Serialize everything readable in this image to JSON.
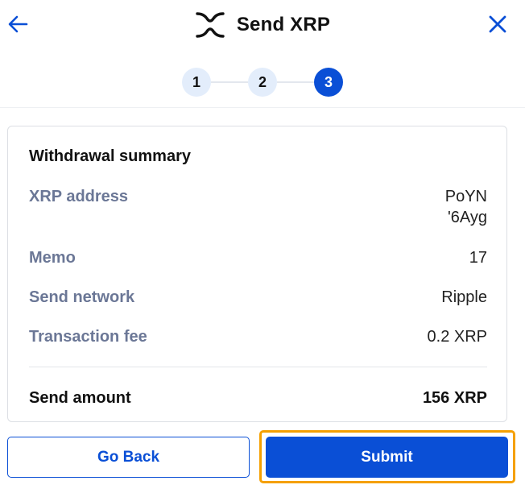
{
  "header": {
    "title": "Send XRP",
    "back_icon": "arrow-left-icon",
    "close_icon": "close-icon",
    "logo_icon": "xrp-logo-icon",
    "accent_color": "#0a4fd6"
  },
  "steps": [
    {
      "label": "1",
      "active": false
    },
    {
      "label": "2",
      "active": false
    },
    {
      "label": "3",
      "active": true
    }
  ],
  "summary": {
    "title": "Withdrawal summary",
    "address_label": "XRP address",
    "address_line1": "PoYN",
    "address_line2": "'6Ayg",
    "memo_label": "Memo",
    "memo_value": "17",
    "network_label": "Send network",
    "network_value": "Ripple",
    "fee_label": "Transaction fee",
    "fee_value": "0.2 XRP",
    "amount_label": "Send amount",
    "amount_value": "156 XRP"
  },
  "actions": {
    "back_label": "Go Back",
    "submit_label": "Submit"
  }
}
